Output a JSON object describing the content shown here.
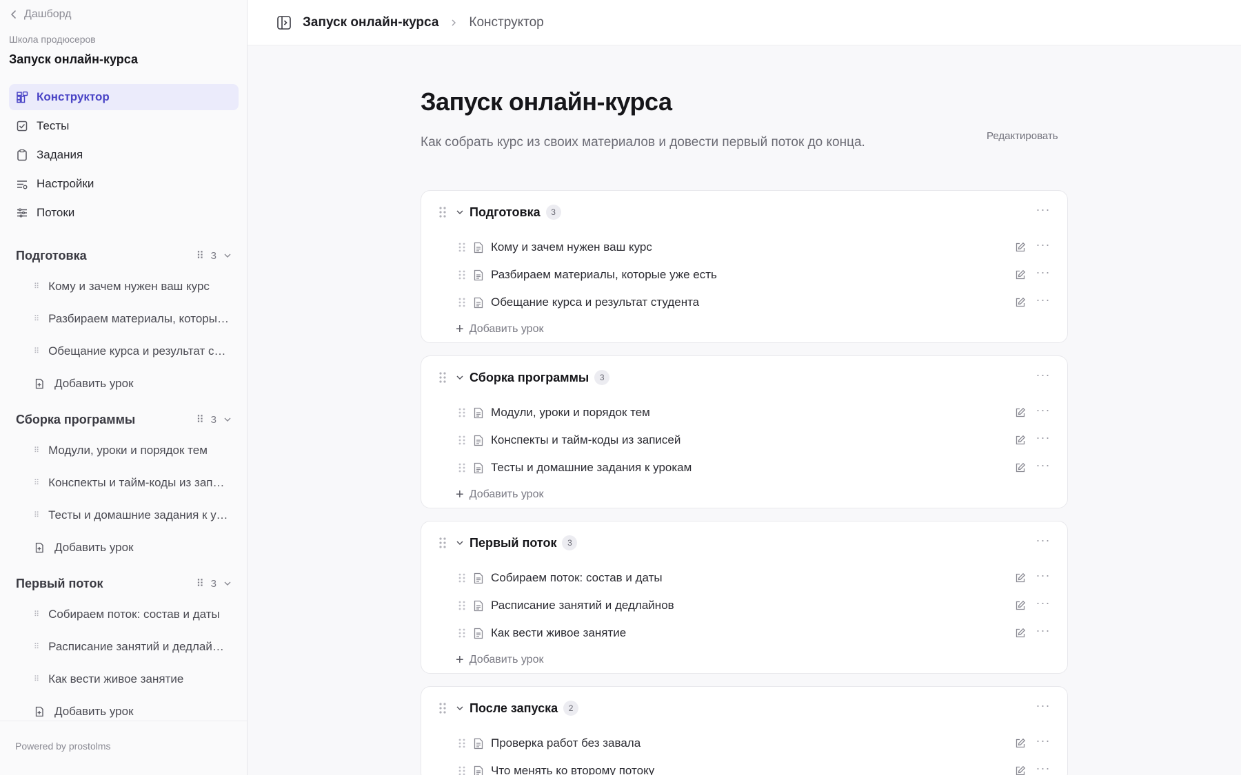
{
  "sidebar": {
    "back_label": "Дашборд",
    "school": "Школа продюсеров",
    "course": "Запуск онлайн-курса",
    "nav": [
      {
        "label": "Конструктор",
        "icon": "grid-icon",
        "active": true
      },
      {
        "label": "Тесты",
        "icon": "checkbox-icon"
      },
      {
        "label": "Задания",
        "icon": "clipboard-icon"
      },
      {
        "label": "Настройки",
        "icon": "settings-sliders-icon"
      },
      {
        "label": "Потоки",
        "icon": "filter-lines-icon"
      }
    ],
    "sections": [
      {
        "title": "Подготовка",
        "count": "3",
        "lessons": [
          "Кому и зачем нужен ваш курс",
          "Разбираем материалы, которые уже есть",
          "Обещание курса и результат студента"
        ],
        "add": "Добавить урок"
      },
      {
        "title": "Сборка программы",
        "count": "3",
        "lessons": [
          "Модули, уроки и порядок тем",
          "Конспекты и тайм-коды из записей",
          "Тесты и домашние задания к урокам"
        ],
        "add": "Добавить урок"
      },
      {
        "title": "Первый поток",
        "count": "3",
        "lessons": [
          "Собираем поток: состав и даты",
          "Расписание занятий и дедлайнов",
          "Как вести живое занятие"
        ],
        "add": "Добавить урок"
      }
    ],
    "powered": "Powered by prostolms"
  },
  "topbar": {
    "crumb_main": "Запуск онлайн-курса",
    "crumb_current": "Конструктор"
  },
  "main": {
    "title": "Запуск онлайн-курса",
    "description": "Как собрать курс из своих материалов и довести первый поток до конца.",
    "edit_label": "Редактировать",
    "add_lesson_label": "Добавить урок",
    "sections": [
      {
        "title": "Подготовка",
        "count": "3",
        "lessons": [
          "Кому и зачем нужен ваш курс",
          "Разбираем материалы, которые уже есть",
          "Обещание курса и результат студента"
        ]
      },
      {
        "title": "Сборка программы",
        "count": "3",
        "lessons": [
          "Модули, уроки и порядок тем",
          "Конспекты и тайм-коды из записей",
          "Тесты и домашние задания к урокам"
        ]
      },
      {
        "title": "Первый поток",
        "count": "3",
        "lessons": [
          "Собираем поток: состав и даты",
          "Расписание занятий и дедлайнов",
          "Как вести живое занятие"
        ]
      },
      {
        "title": "После запуска",
        "count": "2",
        "lessons": [
          "Проверка работ без завала",
          "Что менять ко второму потоку"
        ]
      }
    ]
  },
  "colors": {
    "accent": "#4a44c6",
    "active_bg": "#ebebfb"
  }
}
